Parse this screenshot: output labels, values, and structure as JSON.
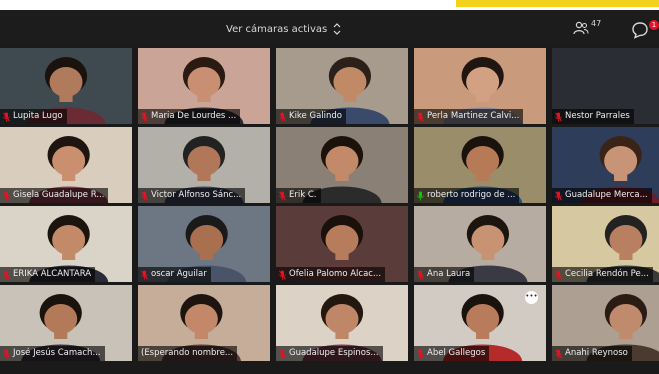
{
  "header": {
    "view_label": "Ver cámaras activas",
    "participants_count": "47",
    "chat_badge": "1"
  },
  "colors": {
    "accent_yellow": "#f2d21b",
    "muted_mic": "#e81123",
    "active_mic": "#16c60c"
  },
  "tiles": [
    {
      "name": "Lupita Lugo",
      "mic": "muted"
    },
    {
      "name": "Maria De Lourdes ...",
      "mic": "muted"
    },
    {
      "name": "Kike Galindo",
      "mic": "muted"
    },
    {
      "name": "Perla Martinez Calvi...",
      "mic": "muted"
    },
    {
      "name": "Nestor Parrales",
      "mic": "muted"
    },
    {
      "name": "Gisela Guadalupe R...",
      "mic": "muted"
    },
    {
      "name": "Victor Alfonso Sánc...",
      "mic": "muted"
    },
    {
      "name": "Erik C.",
      "mic": "muted"
    },
    {
      "name": "roberto rodrigo de ...",
      "mic": "active"
    },
    {
      "name": "Guadalupe Merca...",
      "mic": "muted"
    },
    {
      "name": "ERIKA ALCANTARA",
      "mic": "muted"
    },
    {
      "name": "oscar Aguilar",
      "mic": "muted"
    },
    {
      "name": "Ofelia Palomo Alcac...",
      "mic": "muted"
    },
    {
      "name": "Ana Laura",
      "mic": "muted"
    },
    {
      "name": "Cecilia Rendón Pe...",
      "mic": "muted"
    },
    {
      "name": "José Jesús Camach...",
      "mic": "muted"
    },
    {
      "name": "(Esperando nombre...",
      "mic": "none"
    },
    {
      "name": "Guadalupe Espinos...",
      "mic": "muted"
    },
    {
      "name": "Abel Gallegos",
      "mic": "muted"
    },
    {
      "name": "Anahi Reynoso",
      "mic": "muted"
    }
  ]
}
